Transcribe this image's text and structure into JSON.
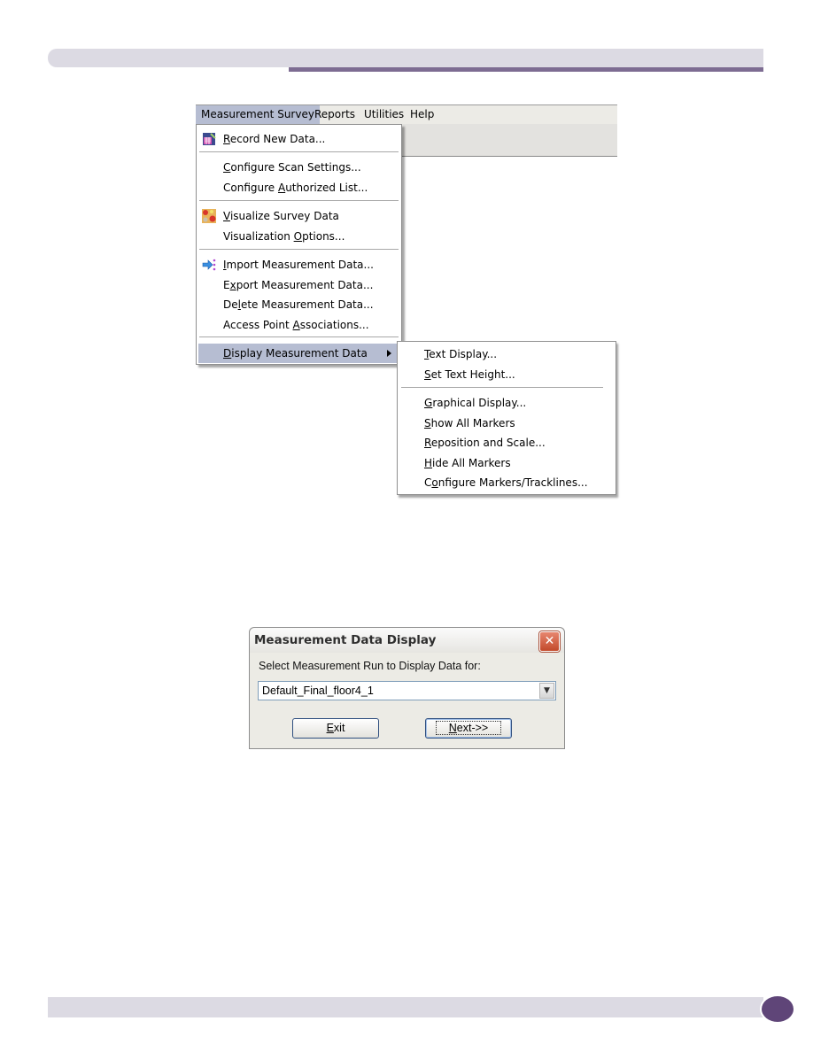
{
  "page": {
    "accent_color": "#7d6c92",
    "bar_color": "#dcdae3",
    "page_badge_color": "#5f4578"
  },
  "menubar": {
    "items": [
      {
        "label": "Measurement Survey",
        "active": true
      },
      {
        "label": "Reports"
      },
      {
        "label": "Utilities"
      },
      {
        "label": "Help"
      }
    ]
  },
  "menu": {
    "items": [
      {
        "label": "Record New Data...",
        "mnemonic": "R",
        "icon": "record-data-icon"
      },
      {
        "label": "Configure Scan Settings...",
        "mnemonic": "C"
      },
      {
        "label": "Configure Authorized List...",
        "mnemonic": "A"
      },
      {
        "label": "Visualize Survey Data",
        "mnemonic": "V",
        "icon": "visualize-icon"
      },
      {
        "label": "Visualization Options...",
        "mnemonic": "O"
      },
      {
        "label": "Import Measurement Data...",
        "mnemonic": "I",
        "icon": "import-icon"
      },
      {
        "label": "Export Measurement Data...",
        "mnemonic": "x"
      },
      {
        "label": "Delete Measurement Data...",
        "mnemonic": "l"
      },
      {
        "label": "Access Point Associations...",
        "mnemonic": "A"
      },
      {
        "label": "Display Measurement Data",
        "mnemonic": "D",
        "highlighted": true,
        "has_submenu": true
      }
    ]
  },
  "submenu": {
    "items": [
      {
        "label": "Text Display...",
        "mnemonic": "T"
      },
      {
        "label": "Set Text Height...",
        "mnemonic": "S"
      },
      {
        "label": "Graphical Display...",
        "mnemonic": "G"
      },
      {
        "label": "Show All Markers",
        "mnemonic": "S"
      },
      {
        "label": "Reposition and Scale...",
        "mnemonic": "R"
      },
      {
        "label": "Hide All Markers",
        "mnemonic": "H"
      },
      {
        "label": "Configure Markers/Tracklines...",
        "mnemonic": "o"
      }
    ]
  },
  "dialog": {
    "title": "Measurement Data Display",
    "close_glyph": "✕",
    "prompt": "Select Measurement Run to Display Data for:",
    "selected_run": "Default_Final_floor4_1",
    "dropdown_glyph": "⌄",
    "exit_label": "Exit",
    "next_label": "Next->>"
  }
}
